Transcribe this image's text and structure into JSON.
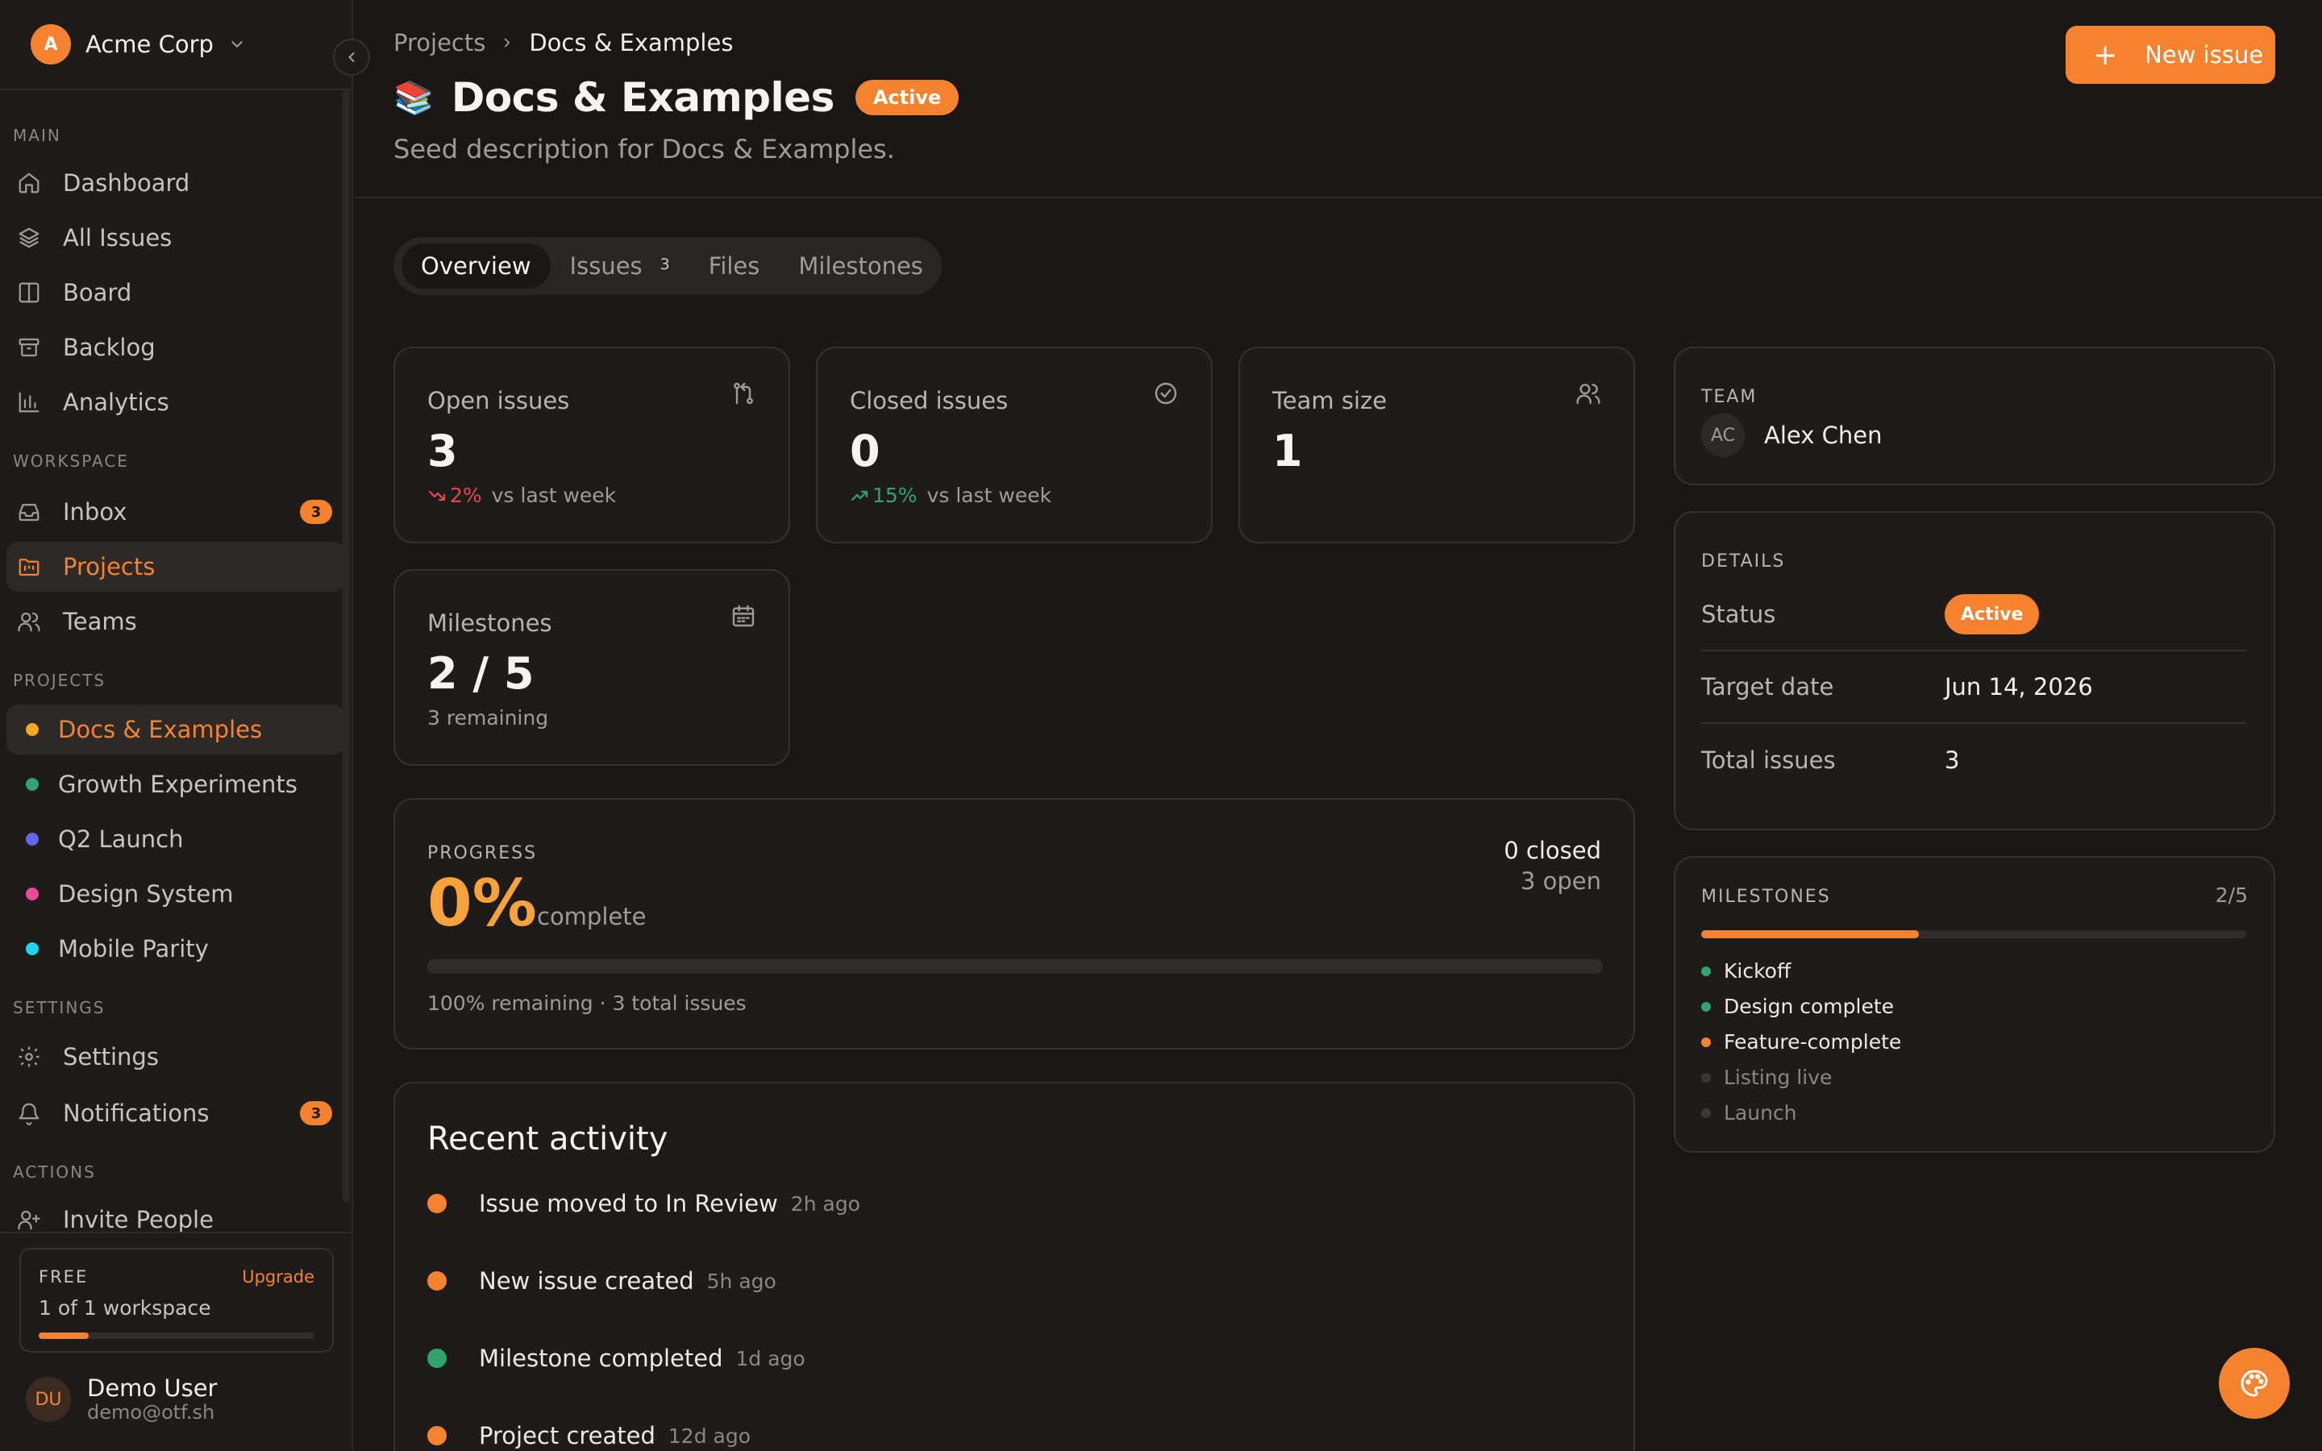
{
  "workspace": {
    "name": "Acme Corp",
    "initial": "A"
  },
  "sidebar": {
    "sections": {
      "main": "MAIN",
      "workspace": "WORKSPACE",
      "projects": "PROJECTS",
      "settings": "SETTINGS",
      "actions": "ACTIONS"
    },
    "main_items": [
      {
        "label": "Dashboard",
        "icon": "home-icon"
      },
      {
        "label": "All Issues",
        "icon": "layers-icon"
      },
      {
        "label": "Board",
        "icon": "columns-icon"
      },
      {
        "label": "Backlog",
        "icon": "archive-icon"
      },
      {
        "label": "Analytics",
        "icon": "bar-chart-icon"
      }
    ],
    "workspace_items": [
      {
        "label": "Inbox",
        "icon": "inbox-icon",
        "badge": "3"
      },
      {
        "label": "Projects",
        "icon": "folder-kanban-icon",
        "active": true
      },
      {
        "label": "Teams",
        "icon": "users-icon"
      }
    ],
    "projects": [
      {
        "label": "Docs & Examples",
        "color": "#f5a623",
        "active": true
      },
      {
        "label": "Growth Experiments",
        "color": "#30a46c"
      },
      {
        "label": "Q2 Launch",
        "color": "#6366f1"
      },
      {
        "label": "Design System",
        "color": "#ec4899"
      },
      {
        "label": "Mobile Parity",
        "color": "#22d3ee"
      }
    ],
    "settings_items": [
      {
        "label": "Settings",
        "icon": "gear-icon"
      },
      {
        "label": "Notifications",
        "icon": "bell-icon",
        "badge": "3"
      }
    ],
    "actions_items": [
      {
        "label": "Invite People",
        "icon": "user-plus-icon"
      }
    ],
    "plan": {
      "tier": "FREE",
      "upgrade": "Upgrade",
      "usage": "1 of 1 workspace",
      "usage_fraction": 0.18
    },
    "user": {
      "initials": "DU",
      "name": "Demo User",
      "email": "demo@otf.sh"
    }
  },
  "header": {
    "breadcrumb": {
      "root": "Projects",
      "current": "Docs & Examples"
    },
    "emoji": "📚",
    "title": "Docs & Examples",
    "status": "Active",
    "description": "Seed description for Docs & Examples.",
    "new_issue": "New issue"
  },
  "tabs": [
    {
      "label": "Overview",
      "active": true
    },
    {
      "label": "Issues",
      "count": "3"
    },
    {
      "label": "Files"
    },
    {
      "label": "Milestones"
    }
  ],
  "stats": {
    "open": {
      "label": "Open issues",
      "value": "3",
      "trend": "2%",
      "trend_dir": "down",
      "trend_suffix": "vs last week",
      "icon": "git-pull-request-icon"
    },
    "closed": {
      "label": "Closed issues",
      "value": "0",
      "trend": "15%",
      "trend_dir": "up",
      "trend_suffix": "vs last week",
      "icon": "check-circle-icon"
    },
    "team": {
      "label": "Team size",
      "value": "1",
      "icon": "users-icon"
    },
    "milestones": {
      "label": "Milestones",
      "value": "2 / 5",
      "sub": "3 remaining",
      "icon": "calendar-icon"
    }
  },
  "progress": {
    "label": "PROGRESS",
    "percent": "0%",
    "percent_value": 0,
    "complete": "complete",
    "closed": "0 closed",
    "open": "3 open",
    "footer": "100% remaining · 3 total issues"
  },
  "activity": {
    "title": "Recent activity",
    "items": [
      {
        "text": "Issue moved to In Review",
        "time": "2h ago",
        "color": "#f5822f"
      },
      {
        "text": "New issue created",
        "time": "5h ago",
        "color": "#f5822f"
      },
      {
        "text": "Milestone completed",
        "time": "1d ago",
        "color": "#30a46c"
      },
      {
        "text": "Project created",
        "time": "12d ago",
        "color": "#f5822f"
      }
    ]
  },
  "team_card": {
    "label": "TEAM",
    "members": [
      {
        "initials": "AC",
        "name": "Alex Chen"
      }
    ]
  },
  "details": {
    "label": "DETAILS",
    "status_key": "Status",
    "status_val": "Active",
    "target_key": "Target date",
    "target_val": "Jun 14, 2026",
    "total_key": "Total issues",
    "total_val": "3"
  },
  "milestones_card": {
    "label": "MILESTONES",
    "count": "2/5",
    "progress_fraction": 0.4,
    "items": [
      {
        "label": "Kickoff",
        "state": "done",
        "color": "#30a46c"
      },
      {
        "label": "Design complete",
        "state": "done",
        "color": "#30a46c"
      },
      {
        "label": "Feature-complete",
        "state": "in-progress",
        "color": "#f5822f"
      },
      {
        "label": "Listing live",
        "state": "pending",
        "color": "#3a3734"
      },
      {
        "label": "Launch",
        "state": "pending",
        "color": "#3a3734"
      }
    ]
  }
}
